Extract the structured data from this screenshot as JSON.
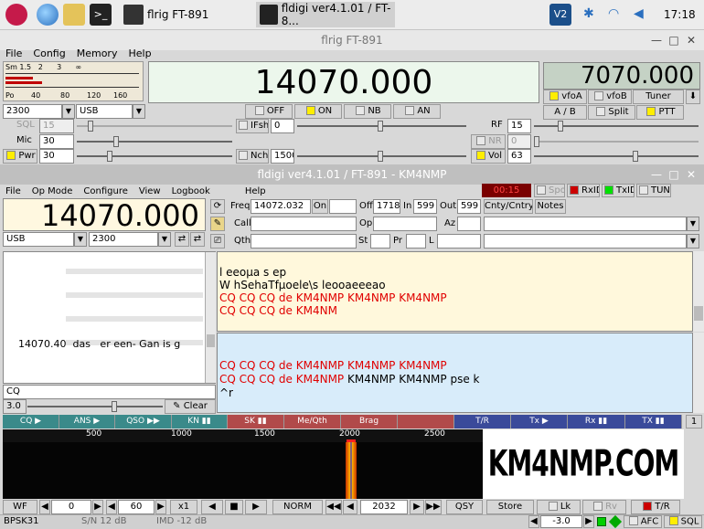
{
  "taskbar": {
    "flrig_task": "flrig FT-891",
    "fldigi_task": "fldigi ver4.1.01 / FT-8...",
    "time": "17:18"
  },
  "flrig": {
    "title": "flrig FT-891",
    "menu": [
      "File",
      "Config",
      "Memory",
      "Help"
    ],
    "meter_scale_top": "Sm 1.5   2      3      ∞",
    "meter_scale_bottom": [
      "Po",
      "40",
      "80",
      "120",
      "160"
    ],
    "freq_a": "14070.000",
    "freq_b": "7070.000",
    "vfoA": "vfoA",
    "vfoB": "vfoB",
    "tuner": "Tuner",
    "ab": "A / B",
    "split": "Split",
    "ptt": "PTT",
    "bw": "2300",
    "mode": "USB",
    "off": "OFF",
    "on": "ON",
    "nb": "NB",
    "an": "AN",
    "sql_label": "SQL",
    "sql_val": "15",
    "ifsh_label": "IFsh",
    "ifsh_val": "0",
    "rf_label": "RF",
    "rf_val": "15",
    "mic_label": "Mic",
    "mic_val": "30",
    "nr_label": "NR",
    "nr_val": "0",
    "pwr_label": "Pwr",
    "pwr_val": "30",
    "nch_label": "Nch",
    "nch_val": "1500",
    "vol_label": "Vol",
    "vol_val": "63"
  },
  "fldigi": {
    "title": "fldigi ver4.1.01 / FT-891 - KM4NMP",
    "menu": [
      "File",
      "Op Mode",
      "Configure",
      "View",
      "Logbook",
      "Help"
    ],
    "clock": "00:15",
    "spot": "Spot",
    "rxid": "RxID",
    "txid": "TxID",
    "tune": "TUNE",
    "freq_display": "14070.000",
    "mode": "USB",
    "bw": "2300",
    "freq_label": "Freq",
    "freq_val": "14072.032",
    "on_label": "On",
    "off_label": "Off",
    "off_val": "1718",
    "in_label": "In",
    "in_val": "599",
    "out_label": "Out",
    "out_val": "599",
    "cnty": "Cnty/Cntry",
    "notes": "Notes",
    "call_label": "Call",
    "op_label": "Op",
    "az_label": "Az",
    "qth_label": "Qth",
    "st_label": "St",
    "pr_label": "Pr",
    "l_label": "L",
    "browser_line": "14070.40  das   er een- Gan is g",
    "cq_field": "CQ",
    "squelch_val": "3.0",
    "clear": "Clear",
    "rx_lines": [
      {
        "text": "l eeoµa  s ep",
        "color": "black"
      },
      {
        "text": "W  hSehaTfµoele\\s leooaeeeao",
        "color": "black"
      },
      {
        "text": "CQ CQ CQ de KM4NMP KM4NMP KM4NMP",
        "color": "red"
      },
      {
        "text": "CQ CQ CQ de KM4NM",
        "color": "red"
      }
    ],
    "tx_line1": "CQ CQ CQ de KM4NMP KM4NMP KM4NMP",
    "tx_line2_red": "CQ CQ CQ de KM4NMP ",
    "tx_line2_black": "KM4NMP KM4NMP pse k",
    "tx_line3": "^r",
    "macros": [
      {
        "label": "CQ ▶",
        "color": "#3a8a8a"
      },
      {
        "label": "ANS ▶",
        "color": "#3a8a8a"
      },
      {
        "label": "QSO ▶▶",
        "color": "#3a8a8a"
      },
      {
        "label": "KN ▮▮",
        "color": "#3a8a8a"
      },
      {
        "label": "SK ▮▮",
        "color": "#b14a4a"
      },
      {
        "label": "Me/Qth",
        "color": "#b14a4a"
      },
      {
        "label": "Brag",
        "color": "#b14a4a"
      },
      {
        "label": "",
        "color": "#b14a4a"
      },
      {
        "label": "T/R",
        "color": "#3a4a9a"
      },
      {
        "label": "Tx ▶",
        "color": "#3a4a9a"
      },
      {
        "label": "Rx ▮▮",
        "color": "#3a4a9a"
      },
      {
        "label": "TX ▮▮",
        "color": "#3a4a9a"
      }
    ],
    "macro_set": "1",
    "wf_scale": [
      "500",
      "1000",
      "1500",
      "2000",
      "2500"
    ],
    "banner": "KM4NMP.COM",
    "wf_btn": "WF",
    "wf_val1": "0",
    "wf_val2": "60",
    "zoom": "x1",
    "norm": "NORM",
    "audio_freq": "2032",
    "qsy": "QSY",
    "store": "Store",
    "lk": "Lk",
    "rv": "Rv",
    "tr": "T/R",
    "status_mode": "BPSK31",
    "status_sn": "S/N 12 dB",
    "status_imd": "IMD -12 dB",
    "afc_val": "-3.0",
    "afc": "AFC",
    "sql": "SQL",
    "accent_red": "#e00000"
  }
}
